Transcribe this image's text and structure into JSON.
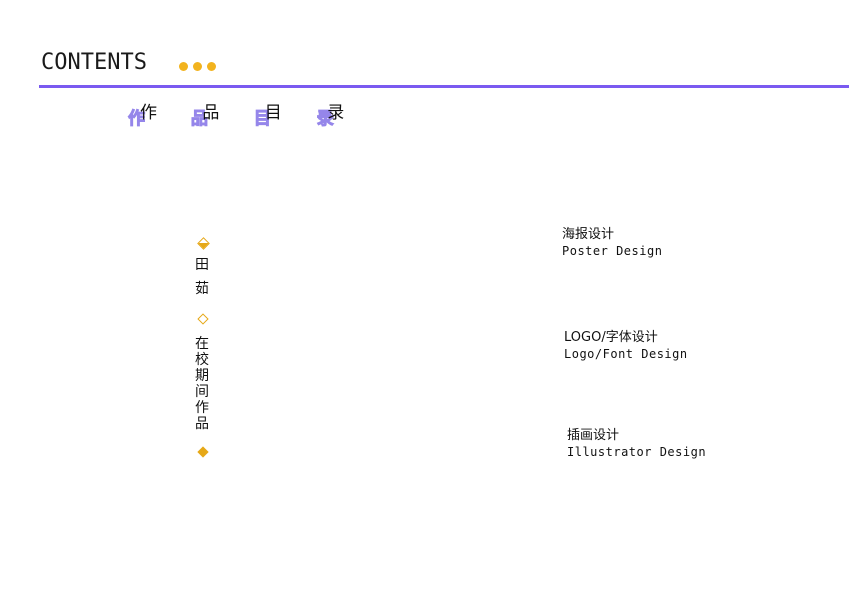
{
  "header": {
    "title": "CONTENTS"
  },
  "subtitle": {
    "text": "作 品 目 录",
    "chars": [
      "作",
      "品",
      "目",
      "录"
    ]
  },
  "left_column": {
    "name_chars": [
      "田",
      "茹"
    ],
    "school_chars": [
      "在",
      "校",
      "期",
      "间",
      "作",
      "品"
    ]
  },
  "menu": [
    {
      "cn": "海报设计",
      "en": "Poster Design"
    },
    {
      "cn": "LOGO/字体设计",
      "en": "Logo/Font Design"
    },
    {
      "cn": "插画设计",
      "en": "Illustrator Design"
    }
  ],
  "colors": {
    "accent_purple": "#7a5af0",
    "accent_gold": "#f2b31e"
  }
}
